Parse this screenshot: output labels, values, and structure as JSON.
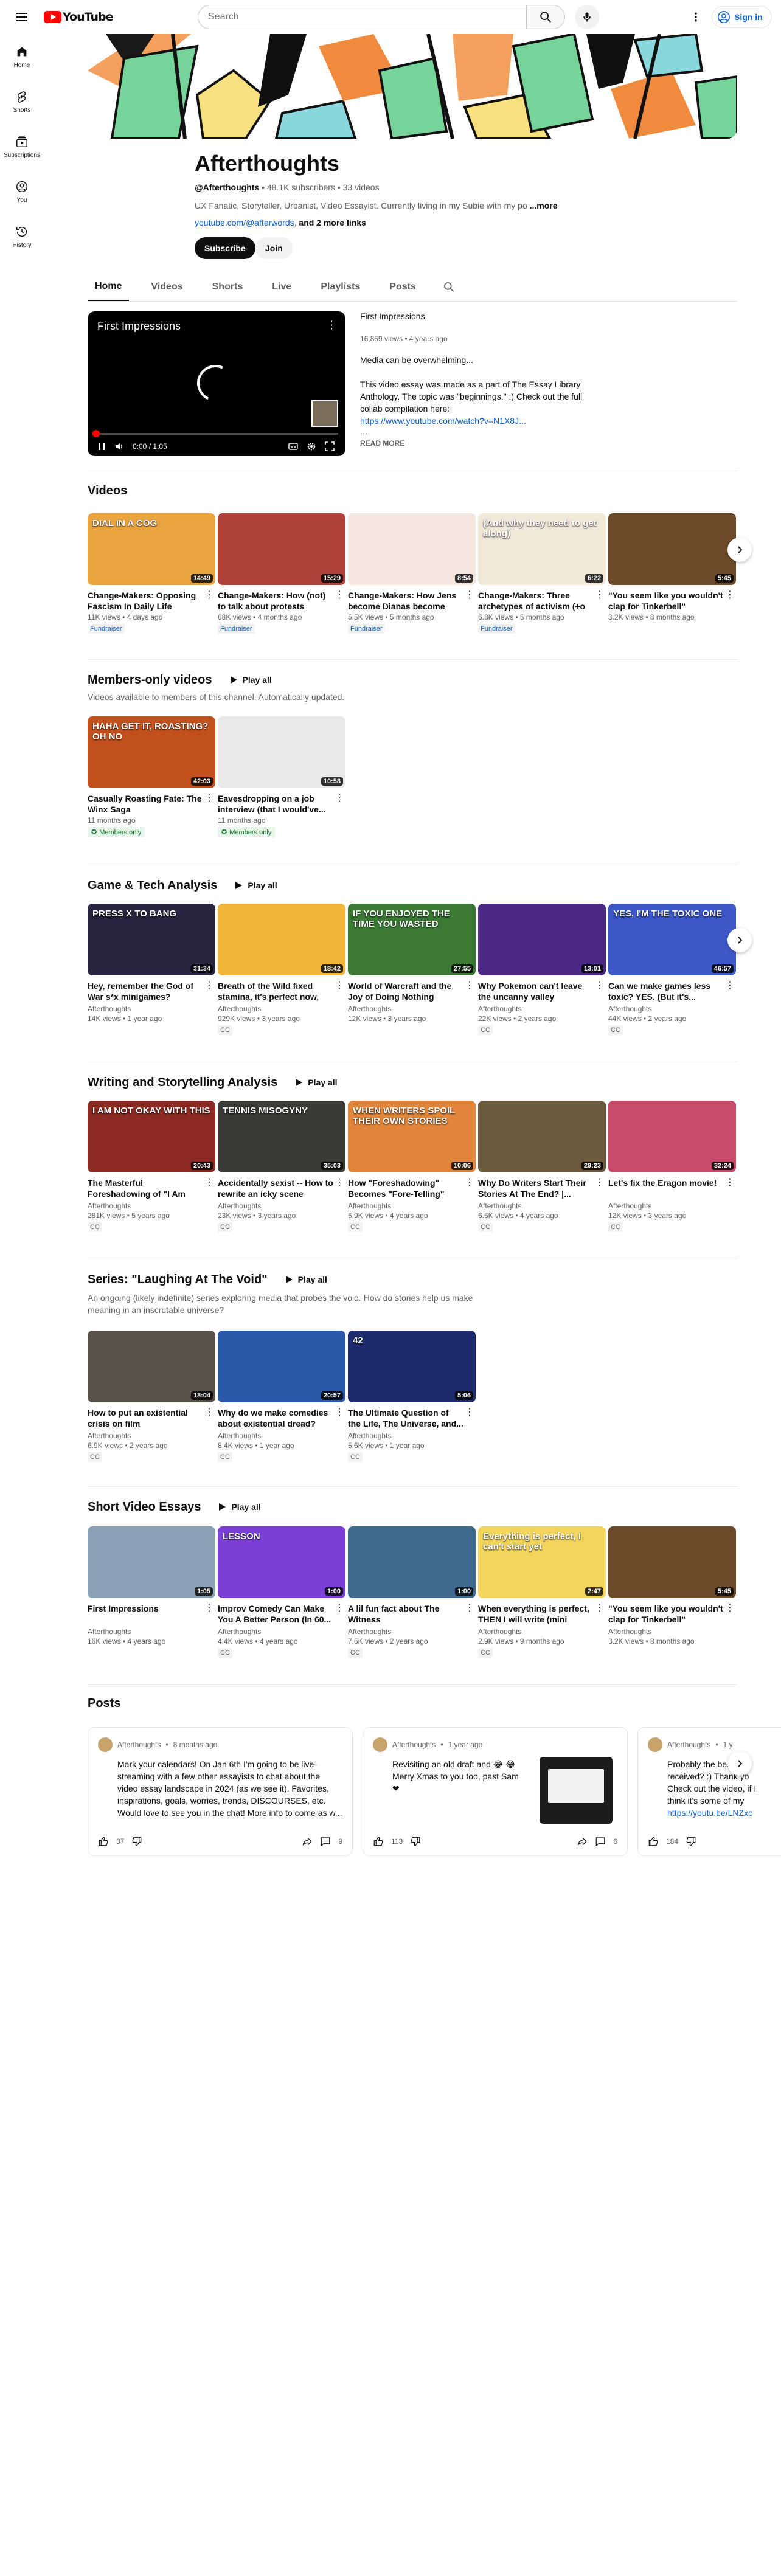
{
  "masthead": {
    "logo_text": "YouTube",
    "search_placeholder": "Search",
    "signin_label": "Sign in"
  },
  "guide": [
    {
      "label": "Home",
      "icon": "home-icon"
    },
    {
      "label": "Shorts",
      "icon": "shorts-icon"
    },
    {
      "label": "Subscriptions",
      "icon": "subscriptions-icon"
    },
    {
      "label": "You",
      "icon": "you-icon"
    },
    {
      "label": "History",
      "icon": "history-icon"
    }
  ],
  "channel": {
    "name": "Afterthoughts",
    "handle": "@Afterthoughts",
    "subscribers": "48.1K subscribers",
    "videos": "33 videos",
    "description": "UX Fanatic, Storyteller, Urbanist, Video Essayist. Currently living in my Subie with my po",
    "more_label": "...more",
    "link": "youtube.com/@afterwords",
    "more_links": "and 2 more links",
    "subscribe_label": "Subscribe",
    "join_label": "Join"
  },
  "tabs": [
    "Home",
    "Videos",
    "Shorts",
    "Live",
    "Playlists",
    "Posts"
  ],
  "featured": {
    "player_title": "First Impressions",
    "time": "0:00 / 1:05",
    "title": "First Impressions",
    "meta": "16,859 views • 4 years ago",
    "line1": "Media can be overwhelming...",
    "body": "This video essay was made as a part of The Essay Library Anthology. The topic was \"beginnings.\" :) Check out the full collab compilation here:",
    "url": "https://www.youtube.com/watch?v=N1X8J...",
    "dots": "...",
    "read_more": "READ MORE"
  },
  "videos_shelf": {
    "title": "Videos",
    "items": [
      {
        "title": "Change-Makers: Opposing Fascism In Daily Life",
        "meta": "11K views • 4 days ago",
        "duration": "14:49",
        "badge": "Fundraiser",
        "thumb_text": "DIAL IN A COG",
        "bg": "#e9a33f"
      },
      {
        "title": "Change-Makers: How (not) to talk about protests",
        "meta": "68K views • 4 months ago",
        "duration": "15:29",
        "badge": "Fundraiser",
        "thumb_text": "",
        "bg": "#b0403a"
      },
      {
        "title": "Change-Makers: How Jens become Dianas become Ivy...",
        "meta": "5.5K views • 5 months ago",
        "duration": "8:54",
        "badge": "Fundraiser",
        "thumb_text": "",
        "bg": "#f2e6df"
      },
      {
        "title": "Change-Makers: Three archetypes of activism (+o",
        "meta": "6.8K views • 5 months ago",
        "duration": "6:22",
        "badge": "Fundraiser",
        "thumb_text": "(And why they need to get along)",
        "bg": "#efe8d8"
      },
      {
        "title": "\"You seem like you wouldn't clap for Tinkerbell\"",
        "meta": "3.2K views • 8 months ago",
        "duration": "5:45",
        "badge": "",
        "thumb_text": "",
        "bg": "#6b4a2a"
      }
    ]
  },
  "members_shelf": {
    "title": "Members-only videos",
    "play_all": "Play all",
    "subtitle": "Videos available to members of this channel. Automatically updated.",
    "items": [
      {
        "title": "Casually Roasting Fate: The Winx Saga",
        "meta": "11 months ago",
        "duration": "42:03",
        "badge": "Members only",
        "thumb_text": "HAHA GET IT, ROASTING? OH NO",
        "bg": "#c2501d"
      },
      {
        "title": "Eavesdropping on a job interview (that I would've...",
        "meta": "11 months ago",
        "duration": "10:58",
        "badge": "Members only",
        "thumb_text": "",
        "bg": "#e8e8e8"
      }
    ]
  },
  "game_shelf": {
    "title": "Game & Tech Analysis",
    "play_all": "Play all",
    "items": [
      {
        "title": "Hey, remember the God of War s*x minigames?",
        "channel": "Afterthoughts",
        "meta": "14K views • 1 year ago",
        "duration": "31:34",
        "cc": "",
        "thumb_text": "PRESS X TO BANG",
        "bg": "#2a2440"
      },
      {
        "title": "Breath of the Wild fixed stamina, it's perfect now, we...",
        "channel": "Afterthoughts",
        "meta": "929K views • 3 years ago",
        "duration": "18:42",
        "cc": "CC",
        "thumb_text": "",
        "bg": "#f3b63a"
      },
      {
        "title": "World of Warcraft and the Joy of Doing Nothing",
        "channel": "Afterthoughts",
        "meta": "12K views • 3 years ago",
        "duration": "27:55",
        "cc": "",
        "thumb_text": "IF YOU ENJOYED THE TIME YOU WASTED",
        "bg": "#3b7a35"
      },
      {
        "title": "Why Pokemon can't leave the uncanny valley",
        "channel": "Afterthoughts",
        "meta": "22K views • 2 years ago",
        "duration": "13:01",
        "cc": "CC",
        "thumb_text": "",
        "bg": "#4a2a85"
      },
      {
        "title": "Can we make games less toxic? YES. (But it's...",
        "channel": "Afterthoughts",
        "meta": "44K views • 2 years ago",
        "duration": "46:57",
        "cc": "CC",
        "thumb_text": "YES, I'M THE TOXIC ONE",
        "bg": "#3d59c9"
      }
    ]
  },
  "writing_shelf": {
    "title": "Writing and Storytelling Analysis",
    "play_all": "Play all",
    "items": [
      {
        "title": "The Masterful Foreshadowing of \"I Am Not...",
        "channel": "Afterthoughts",
        "meta": "281K views • 5 years ago",
        "duration": "20:43",
        "cc": "CC",
        "thumb_text": "I AM NOT OKAY WITH THIS",
        "bg": "#8a2a22"
      },
      {
        "title": "Accidentally sexist -- How to rewrite an icky scene",
        "channel": "Afterthoughts",
        "meta": "23K views • 3 years ago",
        "duration": "35:03",
        "cc": "CC",
        "thumb_text": "TENNIS MISOGYNY",
        "bg": "#3c3a36"
      },
      {
        "title": "How \"Foreshadowing\" Becomes \"Fore-Telling\"",
        "channel": "Afterthoughts",
        "meta": "5.9K views • 4 years ago",
        "duration": "10:06",
        "cc": "CC",
        "thumb_text": "WHEN WRITERS SPOIL THEIR OWN STORIES",
        "bg": "#e0853a"
      },
      {
        "title": "Why Do Writers Start Their Stories At The End? |...",
        "channel": "Afterthoughts",
        "meta": "6.5K views • 4 years ago",
        "duration": "29:23",
        "cc": "CC",
        "thumb_text": "",
        "bg": "#6c5a3f"
      },
      {
        "title": "Let's fix the Eragon movie!",
        "channel": "Afterthoughts",
        "meta": "12K views • 3 years ago",
        "duration": "32:24",
        "cc": "CC",
        "thumb_text": "",
        "bg": "#c8496a"
      }
    ]
  },
  "void_shelf": {
    "title": "Series: \"Laughing At The Void\"",
    "play_all": "Play all",
    "subtitle": "An ongoing (likely indefinite) series exploring media that probes the void. How do stories help us make meaning in an inscrutable universe?",
    "items": [
      {
        "title": "How to put an existential crisis on film",
        "channel": "Afterthoughts",
        "meta": "6.9K views • 2 years ago",
        "duration": "18:04",
        "cc": "CC",
        "thumb_text": "",
        "bg": "#56524a"
      },
      {
        "title": "Why do we make comedies about existential dread?",
        "channel": "Afterthoughts",
        "meta": "8.4K views • 1 year ago",
        "duration": "20:57",
        "cc": "CC",
        "thumb_text": "",
        "bg": "#2b58a8"
      },
      {
        "title": "The Ultimate Question of the Life, The Universe, and...",
        "channel": "Afterthoughts",
        "meta": "5.6K views • 1 year ago",
        "duration": "5:06",
        "cc": "CC",
        "thumb_text": "42",
        "bg": "#1d2a6b"
      }
    ]
  },
  "short_shelf": {
    "title": "Short Video Essays",
    "play_all": "Play all",
    "items": [
      {
        "title": "First Impressions",
        "channel": "Afterthoughts",
        "meta": "16K views • 4 years ago",
        "duration": "1:05",
        "cc": "",
        "thumb_text": "",
        "bg": "#8aa0b5"
      },
      {
        "title": "Improv Comedy Can Make You A Better Person (In 60...",
        "channel": "Afterthoughts",
        "meta": "4.4K views • 4 years ago",
        "duration": "1:00",
        "cc": "CC",
        "thumb_text": "LESSON",
        "bg": "#7b3fd6"
      },
      {
        "title": "A lil fun fact about The Witness",
        "channel": "Afterthoughts",
        "meta": "7.6K views • 2 years ago",
        "duration": "1:00",
        "cc": "CC",
        "thumb_text": "",
        "bg": "#3f6b8f"
      },
      {
        "title": "When everything is perfect, THEN I will write (mini video...",
        "channel": "Afterthoughts",
        "meta": "2.9K views • 9 months ago",
        "duration": "2:47",
        "cc": "CC",
        "thumb_text": "Everything is perfect, I can't start yet",
        "bg": "#f2d55c"
      },
      {
        "title": "\"You seem like you wouldn't clap for Tinkerbell\"",
        "channel": "Afterthoughts",
        "meta": "3.2K views • 8 months ago",
        "duration": "5:45",
        "cc": "",
        "thumb_text": "",
        "bg": "#6b4a2a"
      }
    ]
  },
  "posts": {
    "title": "Posts",
    "items": [
      {
        "author": "Afterthoughts",
        "time": "8 months ago",
        "text": "Mark your calendars! On Jan 6th I'm going to be live-streaming with a few other essayists to chat about the video essay landscape in 2024 (as we see it). Favorites, inspirations, goals, worries, trends, DISCOURSES, etc. Would love to see you in the chat! More info to come as w...",
        "likes": "37",
        "comments": "9"
      },
      {
        "author": "Afterthoughts",
        "time": "1 year ago",
        "text": "Revisiting an old draft and 😂 😂 Merry Xmas to you too, past Sam ❤",
        "likes": "113",
        "comments": "6"
      },
      {
        "author": "Afterthoughts",
        "time": "1 y",
        "text": "Probably the best received? :) Thank yo Check out the video, if I think it's some of my",
        "link": "https://youtu.be/LNZxc",
        "likes": "184",
        "comments": ""
      }
    ]
  },
  "colors": {
    "accent_red": "#ff0000",
    "link_blue": "#065fd4",
    "members_green": "#137333"
  }
}
